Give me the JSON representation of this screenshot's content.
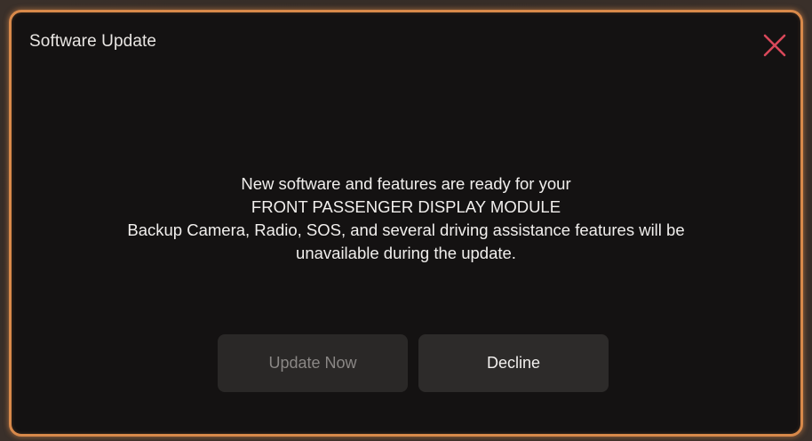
{
  "dialog": {
    "title": "Software Update",
    "close_icon": "close-icon",
    "message": {
      "line1": "New software and features are ready for your",
      "line2": "FRONT PASSENGER DISPLAY MODULE",
      "line3": "Backup Camera, Radio, SOS, and several driving assistance features will be",
      "line4": "unavailable during the update."
    },
    "buttons": {
      "update_now": "Update Now",
      "decline": "Decline"
    }
  },
  "colors": {
    "border_accent": "#d8894a",
    "close_icon": "#d9485a",
    "background": "#141212",
    "button_bg": "#2a2827",
    "disabled_text": "#8a8785"
  }
}
